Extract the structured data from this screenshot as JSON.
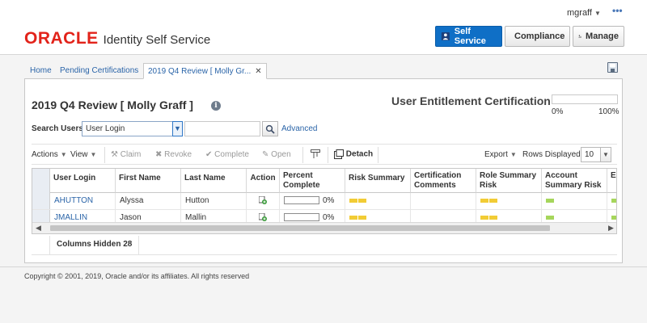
{
  "header": {
    "brand": "ORACLE",
    "product": "Identity Self Service",
    "user": "mgraff",
    "nav": [
      {
        "label": "Self Service",
        "active": true,
        "icon": "self-service-icon"
      },
      {
        "label": "Compliance",
        "active": false,
        "icon": "compliance-icon"
      },
      {
        "label": "Manage",
        "active": false,
        "icon": "manage-icon"
      }
    ]
  },
  "tabs": [
    {
      "label": "Home",
      "closable": false
    },
    {
      "label": "Pending Certifications",
      "closable": true
    },
    {
      "label": "2019 Q4 Review [ Molly Gr...",
      "closable": true,
      "active": true
    }
  ],
  "page": {
    "title": "2019 Q4 Review [ Molly Graff ]",
    "cert_title": "User Entitlement Certification",
    "progress": {
      "value": 0,
      "min_label": "0%",
      "max_label": "100%"
    }
  },
  "search": {
    "label": "Search Users",
    "field": "User Login",
    "value": "",
    "advanced": "Advanced"
  },
  "toolbar": {
    "actions": "Actions",
    "view": "View",
    "claim": "Claim",
    "revoke": "Revoke",
    "complete": "Complete",
    "open": "Open",
    "detach": "Detach",
    "export": "Export",
    "rows_label": "Rows Displayed",
    "rows_value": "10"
  },
  "table": {
    "headers": [
      "User Login",
      "First Name",
      "Last Name",
      "Action",
      "Percent Complete",
      "Risk Summary",
      "Certification Comments",
      "Role Summary Risk",
      "Account Summary Risk",
      "En Su"
    ],
    "rows": [
      {
        "login": "AHUTTON",
        "first": "Alyssa",
        "last": "Hutton",
        "percent": "0%"
      },
      {
        "login": "JMALLIN",
        "first": "Jason",
        "last": "Mallin",
        "percent": "0%"
      }
    ],
    "colors": {
      "risk_yellow": "#f2cc35",
      "risk_green": "#a6d65c"
    }
  },
  "footer": {
    "columns_hidden_label": "Columns Hidden",
    "columns_hidden_count": "28"
  },
  "copyright": "Copyright © 2001, 2019, Oracle and/or its affiliates. All rights reserved"
}
